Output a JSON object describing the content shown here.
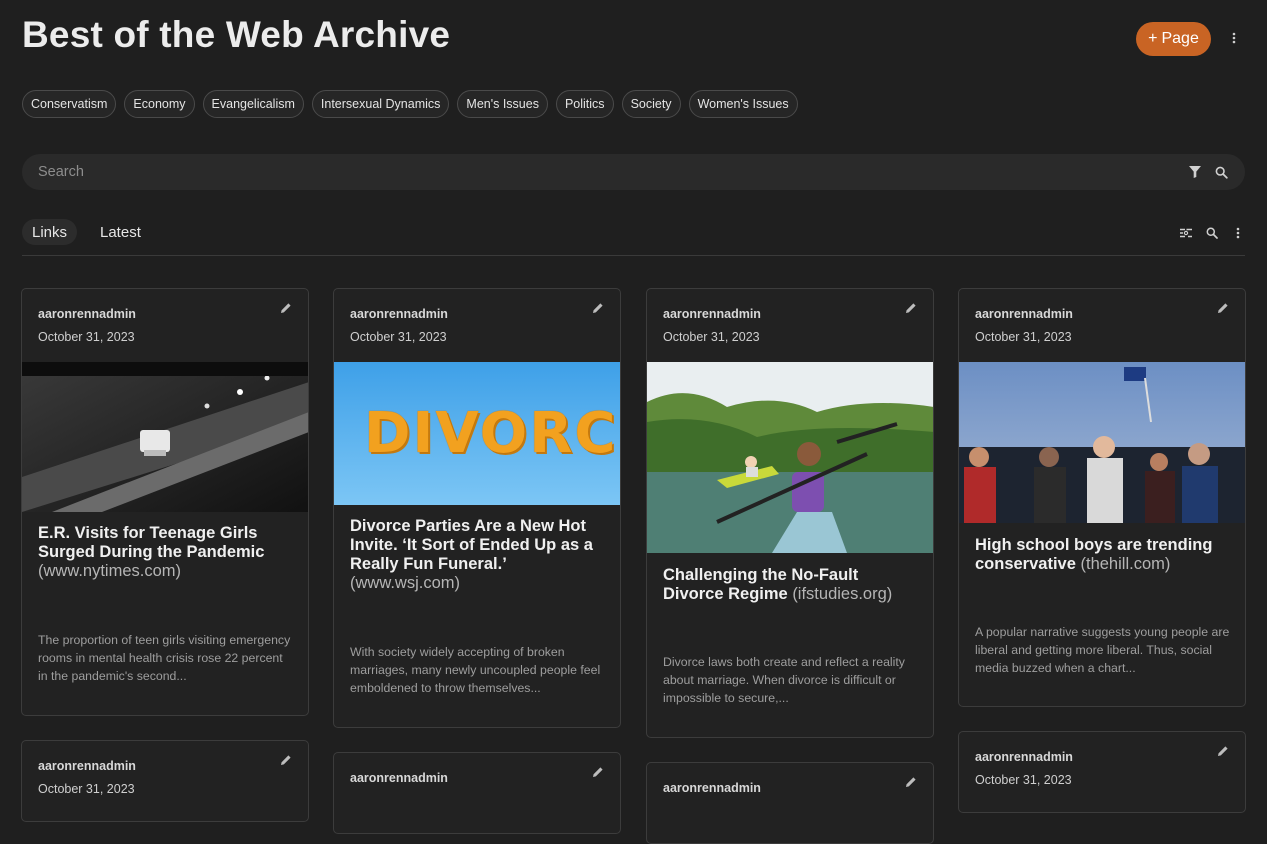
{
  "header": {
    "title": "Best of the Web Archive",
    "page_button": "Page",
    "page_button_icon": "plus-icon"
  },
  "tags": [
    "Conservatism",
    "Economy",
    "Evangelicalism",
    "Intersexual Dynamics",
    "Men's Issues",
    "Politics",
    "Society",
    "Women's Issues"
  ],
  "search": {
    "placeholder": "Search"
  },
  "tabs": [
    "Links",
    "Latest"
  ],
  "cards": [
    {
      "author": "aaronrennadmin",
      "date": "October 31, 2023",
      "title": "E.R. Visits for Teenage Girls Surged During the Pandemic",
      "source": "(www.nytimes.com)",
      "excerpt": "The proportion of teen girls visiting emergency rooms in mental health crisis rose 22 percent in the pandemic's second..."
    },
    {
      "author": "aaronrennadmin",
      "date": "October 31, 2023",
      "title": "Divorce Parties Are a New Hot Invite. ‘It Sort of Ended Up as a Really Fun Funeral.’",
      "source": "(www.wsj.com)",
      "excerpt": "With society widely accepting of broken marriages, many newly uncoupled people feel emboldened to throw themselves...",
      "image_text": "DIVORCE"
    },
    {
      "author": "aaronrennadmin",
      "date": "October 31, 2023",
      "title": "Challenging the No-Fault Divorce Regime",
      "source": "(ifstudies.org)",
      "excerpt": "Divorce laws both create and reflect a reality about marriage. When divorce is difficult or impossible to secure,..."
    },
    {
      "author": "aaronrennadmin",
      "date": "October 31, 2023",
      "title": "High school boys are trending conservative",
      "source": "(thehill.com)",
      "excerpt": "A popular narrative suggests young people are liberal and getting more liberal. Thus, social media buzzed when a chart..."
    }
  ],
  "bottom_cards": [
    {
      "author": "aaronrennadmin",
      "date": "October 31, 2023"
    },
    {
      "author": "aaronrennadmin"
    },
    {
      "author": "aaronrennadmin"
    },
    {
      "author": "aaronrennadmin",
      "date": "October 31, 2023"
    }
  ]
}
